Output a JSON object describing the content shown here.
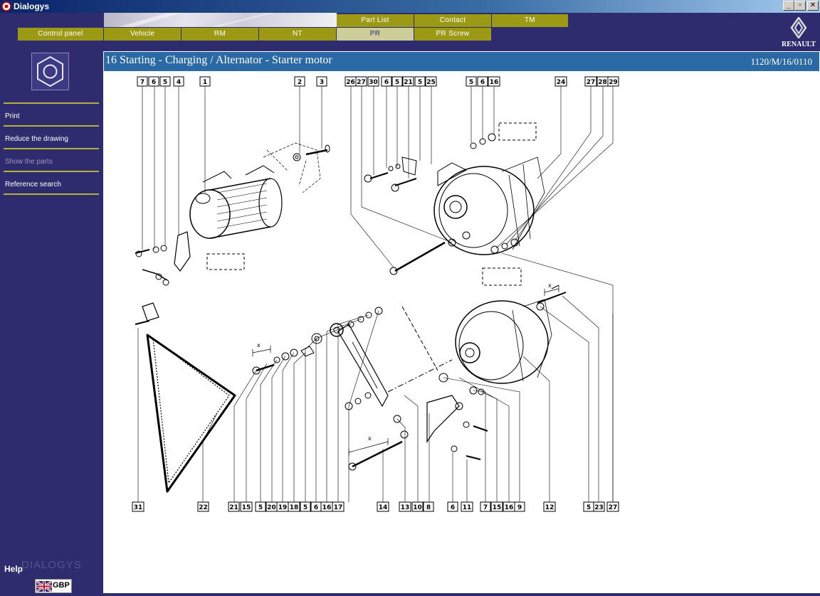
{
  "window": {
    "title": "Dialogys",
    "buttons": [
      "_",
      "▫",
      "✕"
    ]
  },
  "nav": {
    "top_tabs": [
      {
        "label": "Part List"
      },
      {
        "label": "Contact"
      },
      {
        "label": "TM"
      }
    ],
    "main_tabs": [
      {
        "label": "Control panel"
      },
      {
        "label": "Vehicle"
      },
      {
        "label": "RM"
      },
      {
        "label": "NT"
      },
      {
        "label": "PR",
        "active": true
      },
      {
        "label": "PR Screw"
      }
    ]
  },
  "brand": {
    "name": "RENAULT"
  },
  "sidebar": {
    "items": [
      {
        "label": "Print",
        "enabled": true
      },
      {
        "label": "Reduce the drawing",
        "enabled": true
      },
      {
        "label": "Show the parts",
        "enabled": false
      },
      {
        "label": "Reference search",
        "enabled": true
      }
    ],
    "help_label": "Help",
    "logo_text": "DIALOGYS",
    "language": "GBP"
  },
  "page": {
    "title": "16 Starting - Charging / Alternator - Starter motor",
    "reference": "1120/M/16/0110"
  },
  "drawing": {
    "top_labels": [
      "7",
      "6",
      "5",
      "4",
      "1",
      "2",
      "3",
      "26",
      "27",
      "30",
      "6",
      "5",
      "21",
      "5",
      "25",
      "5",
      "6",
      "16",
      "24",
      "27",
      "28",
      "29"
    ],
    "bottom_labels": [
      "31",
      "22",
      "21",
      "15",
      "5",
      "20",
      "19",
      "18",
      "5",
      "6",
      "16",
      "17",
      "14",
      "13",
      "10",
      "8",
      "6",
      "11",
      "7",
      "15",
      "16",
      "9",
      "12",
      "5",
      "23",
      "27"
    ],
    "dimension_mark": "x"
  }
}
